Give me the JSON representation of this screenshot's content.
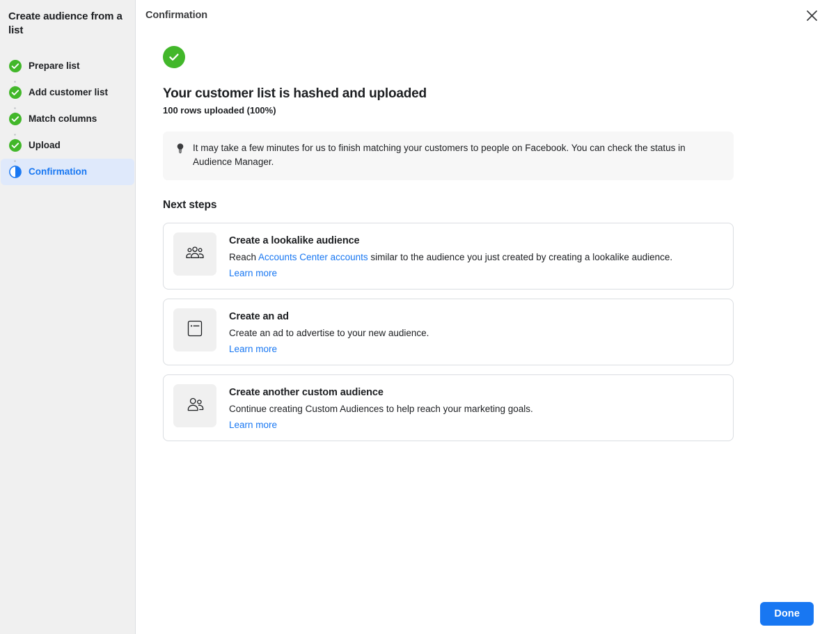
{
  "sidebar": {
    "title": "Create audience from a list",
    "steps": [
      {
        "label": "Prepare list",
        "state": "complete",
        "icon": "check-circle-icon"
      },
      {
        "label": "Add customer list",
        "state": "complete",
        "icon": "check-circle-icon"
      },
      {
        "label": "Match columns",
        "state": "complete",
        "icon": "check-circle-icon"
      },
      {
        "label": "Upload",
        "state": "complete",
        "icon": "check-circle-icon"
      },
      {
        "label": "Confirmation",
        "state": "current",
        "icon": "half-circle-icon"
      }
    ]
  },
  "header": {
    "title": "Confirmation",
    "close_icon": "close-icon"
  },
  "main": {
    "status_icon": "success-check-icon",
    "headline": "Your customer list is hashed and uploaded",
    "subline": "100 rows uploaded (100%)",
    "info_banner": {
      "icon": "lightbulb-icon",
      "text": "It may take a few minutes for us to finish matching your customers to people on Facebook. You can check the status in Audience Manager."
    },
    "section_title": "Next steps",
    "cards": [
      {
        "icon": "people-group-icon",
        "title": "Create a lookalike audience",
        "desc_before": "Reach ",
        "desc_link": "Accounts Center accounts",
        "desc_after": " similar to the audience you just created by creating a lookalike audience.",
        "learn_more": "Learn more"
      },
      {
        "icon": "ad-card-icon",
        "title": "Create an ad",
        "desc_before": "Create an ad to advertise to your new audience.",
        "desc_link": "",
        "desc_after": "",
        "learn_more": "Learn more"
      },
      {
        "icon": "two-people-icon",
        "title": "Create another custom audience",
        "desc_before": "Continue creating Custom Audiences to help reach your marketing goals.",
        "desc_link": "",
        "desc_after": "",
        "learn_more": "Learn more"
      }
    ]
  },
  "footer": {
    "done_label": "Done"
  },
  "colors": {
    "accent": "#1877f2",
    "success": "#42b72a",
    "sidebar_bg": "#f0f0f0",
    "active_step_bg": "#dfe9fb",
    "banner_bg": "#f7f7f7",
    "card_border": "#dadde1"
  }
}
